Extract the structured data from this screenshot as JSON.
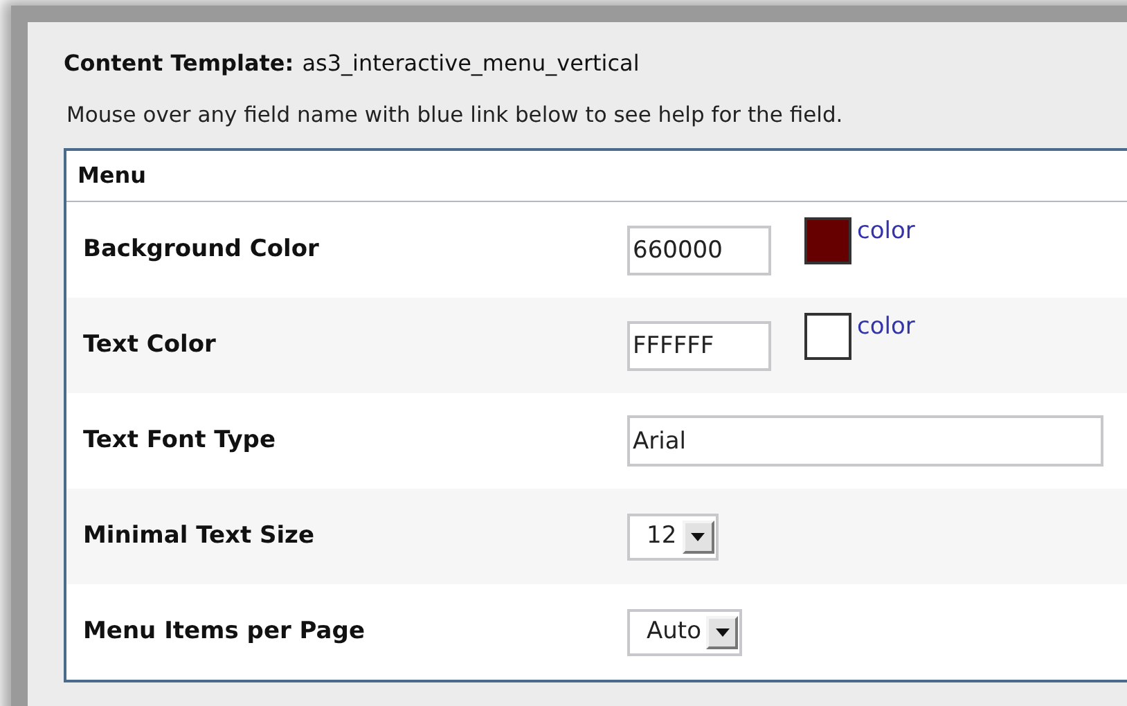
{
  "header": {
    "label": "Content Template:",
    "value": "as3_interactive_menu_vertical"
  },
  "help_text": "Mouse over any field name with blue link below to see help for the field.",
  "section": {
    "title": "Menu",
    "rows": [
      {
        "kind": "color",
        "label": "Background Color",
        "value": "660000",
        "color": "#660000",
        "link": "color"
      },
      {
        "kind": "color",
        "label": "Text Color",
        "value": "FFFFFF",
        "color": "#ffffff",
        "link": "color"
      },
      {
        "kind": "text",
        "label": "Text Font Type",
        "value": "Arial"
      },
      {
        "kind": "select",
        "label": "Minimal Text Size",
        "value": "12"
      },
      {
        "kind": "select",
        "label": "Menu Items per Page",
        "value": "Auto"
      }
    ]
  }
}
